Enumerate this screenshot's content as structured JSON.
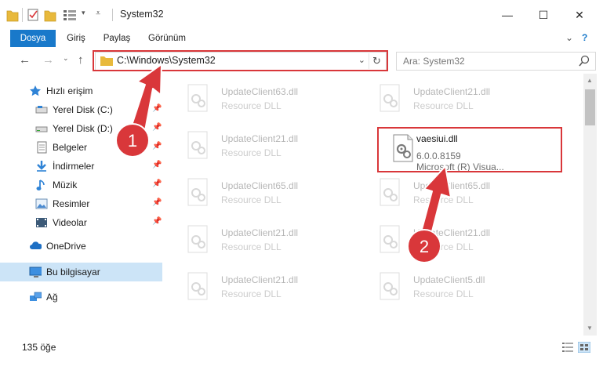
{
  "window": {
    "title": "System32",
    "minimize": "—",
    "maximize": "☐",
    "close": "✕"
  },
  "ribbon": {
    "tabs": [
      "Dosya",
      "Giriş",
      "Paylaş",
      "Görünüm"
    ]
  },
  "address": {
    "path": "C:\\Windows\\System32",
    "dropdown": "⌄",
    "refresh": "↻"
  },
  "search": {
    "placeholder": "Ara: System32"
  },
  "sidebar": {
    "items": [
      {
        "label": "Hızlı erişim",
        "icon": "star-icon"
      },
      {
        "label": "Yerel Disk (C:)",
        "icon": "drive-icon"
      },
      {
        "label": "Yerel Disk (D:)",
        "icon": "drive-icon"
      },
      {
        "label": "Belgeler",
        "icon": "documents-icon"
      },
      {
        "label": "İndirmeler",
        "icon": "download-icon"
      },
      {
        "label": "Müzik",
        "icon": "music-icon"
      },
      {
        "label": "Resimler",
        "icon": "pictures-icon"
      },
      {
        "label": "Videolar",
        "icon": "videos-icon"
      },
      {
        "label": "OneDrive",
        "icon": "cloud-icon"
      },
      {
        "label": "Bu bilgisayar",
        "icon": "computer-icon"
      },
      {
        "label": "Ağ",
        "icon": "network-icon"
      }
    ],
    "pin": "📌"
  },
  "files": [
    {
      "name": "UpdateClient63.dll",
      "desc": "Resource DLL"
    },
    {
      "name": "UpdateClient21.dll",
      "desc": "Resource DLL"
    },
    {
      "name": "UpdateClient21.dll",
      "desc": "Resource DLL"
    },
    {
      "name": "vaesiui.dll",
      "desc": "6.0.0.8159",
      "desc2": "Microsoft (R) Visua..."
    },
    {
      "name": "UpdateClient65.dll",
      "desc": "Resource DLL"
    },
    {
      "name": "UpdateClient65.dll",
      "desc": "Resource DLL"
    },
    {
      "name": "UpdateClient21.dll",
      "desc": "Resource DLL"
    },
    {
      "name": "UpdateClient21.dll",
      "desc": "Resource DLL"
    },
    {
      "name": "UpdateClient21.dll",
      "desc": "Resource DLL"
    },
    {
      "name": "UpdateClient5.dll",
      "desc": "Resource DLL"
    }
  ],
  "status": {
    "item_count": "135 öğe"
  },
  "annotations": {
    "marker1": "1",
    "marker2": "2",
    "color": "#d9373a"
  }
}
